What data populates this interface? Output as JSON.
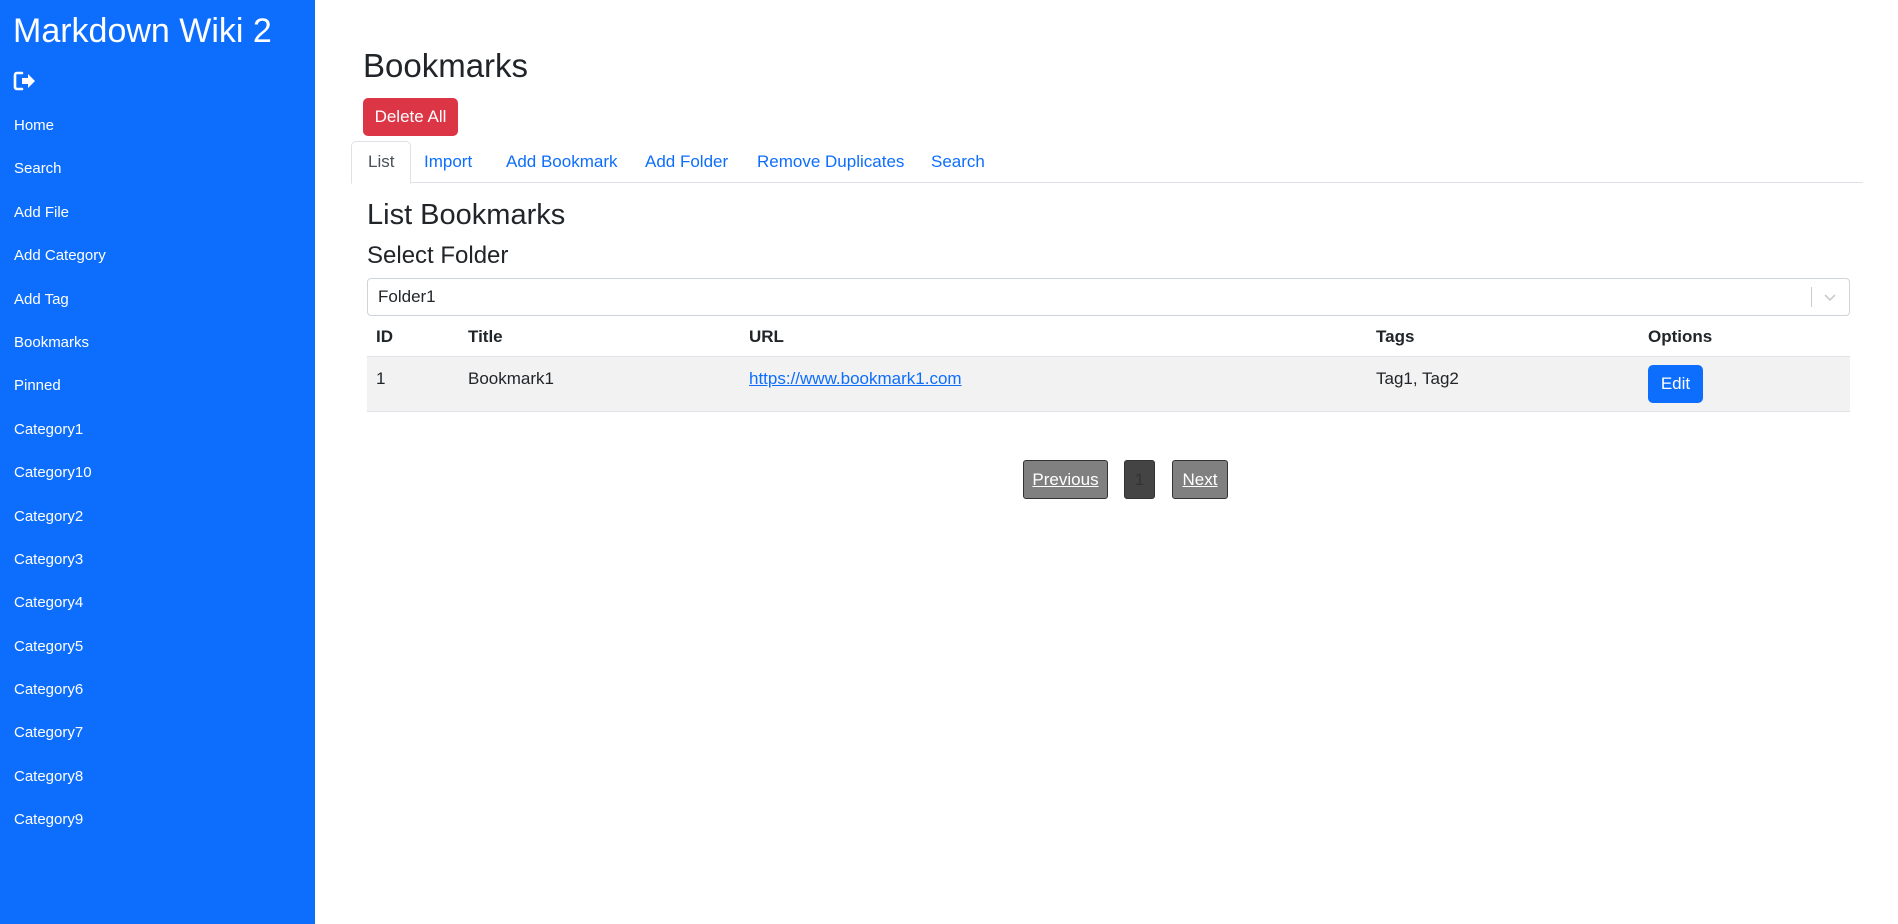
{
  "app": {
    "title": "Markdown Wiki 2",
    "logout_icon": "sign-out-icon"
  },
  "sidebar": {
    "items": [
      {
        "label": "Home"
      },
      {
        "label": "Search"
      },
      {
        "label": "Add File"
      },
      {
        "label": "Add Category"
      },
      {
        "label": "Add Tag"
      },
      {
        "label": "Bookmarks"
      },
      {
        "label": "Pinned"
      },
      {
        "label": "Category1"
      },
      {
        "label": "Category10"
      },
      {
        "label": "Category2"
      },
      {
        "label": "Category3"
      },
      {
        "label": "Category4"
      },
      {
        "label": "Category5"
      },
      {
        "label": "Category6"
      },
      {
        "label": "Category7"
      },
      {
        "label": "Category8"
      },
      {
        "label": "Category9"
      }
    ]
  },
  "page": {
    "title": "Bookmarks",
    "delete_all_label": "Delete All"
  },
  "tabs": [
    {
      "label": "List",
      "active": true
    },
    {
      "label": "Import"
    },
    {
      "label": "Add Bookmark"
    },
    {
      "label": "Add Folder"
    },
    {
      "label": "Remove Duplicates"
    },
    {
      "label": "Search"
    }
  ],
  "list": {
    "title": "List Bookmarks",
    "select_folder_label": "Select Folder",
    "selected_folder": "Folder1",
    "columns": [
      "ID",
      "Title",
      "URL",
      "Tags",
      "Options"
    ],
    "rows": [
      {
        "id": "1",
        "title": "Bookmark1",
        "url": "https://www.bookmark1.com",
        "tags": "Tag1, Tag2",
        "edit_label": "Edit"
      }
    ]
  },
  "pagination": {
    "previous_label": "Previous",
    "current_page": "1",
    "next_label": "Next"
  },
  "colors": {
    "sidebar": "#0d6efd",
    "primary": "#0d6efd",
    "danger": "#dc3545",
    "row_bg": "#f2f2f2"
  }
}
